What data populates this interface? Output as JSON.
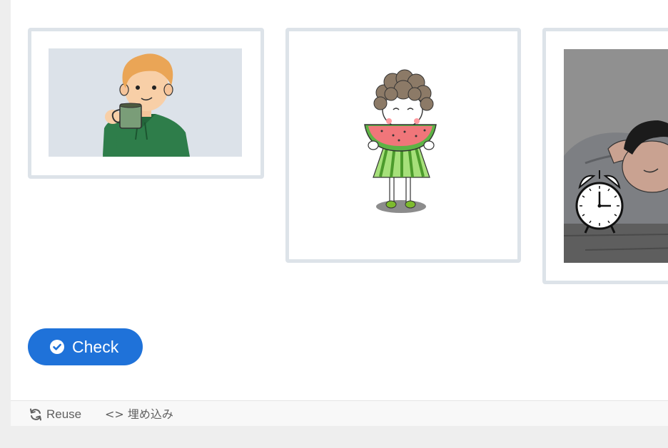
{
  "cards": [
    {
      "name": "man-drinking-coffee"
    },
    {
      "name": "girl-eating-watermelon"
    },
    {
      "name": "man-sleeping-alarm-clock"
    }
  ],
  "check_button": {
    "label": "Check",
    "icon": "check-circle-icon"
  },
  "footer": {
    "reuse": {
      "label": "Reuse",
      "icon": "refresh-icon"
    },
    "embed": {
      "label": "<> 埋め込み"
    }
  },
  "colors": {
    "accent": "#1f72d9",
    "card_border": "#dde3e9",
    "footer_bg": "#f8f8f8",
    "footer_text": "#606060"
  }
}
